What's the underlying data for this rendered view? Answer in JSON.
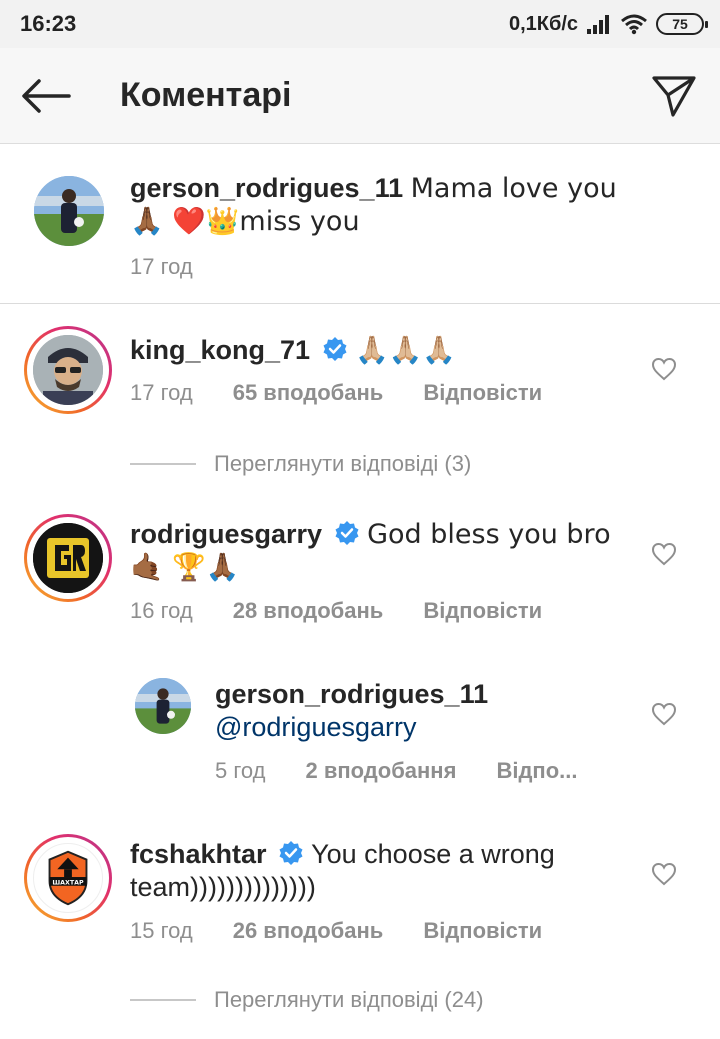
{
  "status_bar": {
    "time": "16:23",
    "net_speed": "0,1Кб/с",
    "battery": "75"
  },
  "header": {
    "title": "Коментарі"
  },
  "caption": {
    "username": "gerson_rodrigues_11",
    "text": "Mama love you 🙏🏾 ❤️👑miss you",
    "time": "17 год"
  },
  "comments": [
    {
      "username": "king_kong_71",
      "text": "🙏🏼🙏🏼🙏🏼",
      "time": "17 год",
      "likes": "65 вподобань",
      "reply": "Відповісти",
      "view_replies": "Переглянути відповіді (3)"
    },
    {
      "username": "rodriguesgarry",
      "text": "God bless you bro🤙🏾 🏆🙏🏾",
      "time": "16 год",
      "likes": "28 вподобань",
      "reply": "Відповісти"
    },
    {
      "username": "fcshakhtar",
      "text": "You choose a wrong team))))))))))))))",
      "time": "15 год",
      "likes": "26 вподобань",
      "reply": "Відповісти",
      "view_replies": "Переглянути відповіді (24)",
      "logo_text": "ШАХТАР"
    }
  ],
  "reply": {
    "username": "gerson_rodrigues_11",
    "mention": "@rodriguesgarry",
    "time": "5 год",
    "likes": "2 вподобання",
    "reply": "Відпо..."
  },
  "colors": {
    "verified": "#3897f0",
    "mention": "#003569",
    "meta": "#8e8e8e"
  }
}
